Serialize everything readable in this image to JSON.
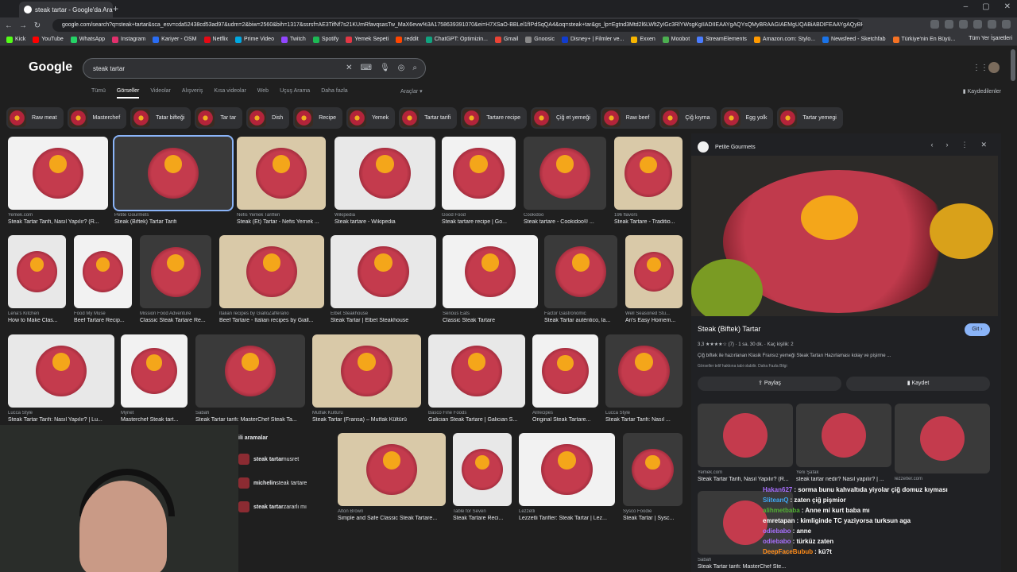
{
  "browser": {
    "tab_title": "steak tartar - Google'da Ara",
    "url": "google.com/search?q=steak+tartar&sca_esv=cda52438cd53ad97&udm=2&biw=2560&bih=1317&ssrsf=AE3TifNf7s21KUmRfavqsasTw_MaX6evw%3A1758639391070&ei=H7XSaO-BBLel1fIPdSqQA4&oq=steak+tar&gs_lp=Egtnd3Mtd2l6LWltZyIGc3RlYWsgKgIIADIIEAAYgAQYsQMyBRAAGIAEMgUQABiABDIFEAAYgAQyBRAAGIA",
    "bookmarks": [
      "Kick",
      "YouTube",
      "WhatsApp",
      "Instagram",
      "Kariyer - OSM",
      "Netflix",
      "Prime Video",
      "Twitch",
      "Spotify",
      "Yemek Sepeti",
      "reddit",
      "ChatGPT: Optimizin...",
      "Gmail",
      "Gnoosic",
      "Disney+ | Filmler ve...",
      "Exxen",
      "Moobot",
      "StreamElements",
      "Amazon.com: Stylo...",
      "Newsfeed - Sketchfab",
      "Türkiye'nin En Büyü..."
    ],
    "bookmarks_right": "Tüm Yer İşaretleri"
  },
  "google": {
    "logo": "Google",
    "query": "steak tartar",
    "nav_tabs": [
      "Tümü",
      "Görseller",
      "Videolar",
      "Alışveriş",
      "Kısa videolar",
      "Web",
      "Uçuş Arama",
      "Daha fazla"
    ],
    "active_tab": "Görseller",
    "tools": "Araçlar",
    "saved": "Kaydedilenler",
    "chips": [
      "Raw meat",
      "Masterchef",
      "Tatar bifteği",
      "Tar tar",
      "Dish",
      "Recipe",
      "Yemek",
      "Tartar tarifi",
      "Tartare recipe",
      "Çiğ et yemeği",
      "Raw beef",
      "Çiğ kıyma",
      "Egg yolk",
      "Tartar yemegi"
    ]
  },
  "results": [
    {
      "src": "Yemek.com",
      "cap": "Steak Tartar Tarifi, Nasıl Yapılır? (R..."
    },
    {
      "src": "Petite Gourmets",
      "cap": "Steak (Biftek) Tartar Tarifi"
    },
    {
      "src": "Nefis Yemek Tarifleri",
      "cap": "Steak (Et) Tartar - Nefis Yemek ..."
    },
    {
      "src": "Wikipedia",
      "cap": "Steak tartare - Wikipedia"
    },
    {
      "src": "Good Food",
      "cap": "Steak tartare recipe | Go..."
    },
    {
      "src": "Cookidoo",
      "cap": "Steak tartare - Cookidoo® ..."
    },
    {
      "src": "196 flavors",
      "cap": "Steak Tartare - Traditio..."
    },
    {
      "src": "Lena's Kitchen",
      "cap": "How to Make Clas..."
    },
    {
      "src": "Food My Muse",
      "cap": "Beef Tartare Recip..."
    },
    {
      "src": "Mission Food Adventure",
      "cap": "Classic Steak Tartare Re..."
    },
    {
      "src": "Italian recipes by GialloZafferano",
      "cap": "Beef Tartare - Italian recipes by Giall..."
    },
    {
      "src": "Elbet Steakhouse",
      "cap": "Steak Tartar | Elbet Steakhouse"
    },
    {
      "src": "Serious Eats",
      "cap": "Classic Steak Tartare"
    },
    {
      "src": "Factor Gastronómic",
      "cap": "Steak Tartar auténtico, la..."
    },
    {
      "src": "Well Seasoned Stu...",
      "cap": "Ari's Easy Homem..."
    },
    {
      "src": "Lucca Style",
      "cap": "Steak Tartar Tarifi: Nasıl Yapılır? | Lu..."
    },
    {
      "src": "Mynet",
      "cap": "Masterchef Steak tart..."
    },
    {
      "src": "Sabah",
      "cap": "Steak Tartar tarifi: MasterChef Steak Ta..."
    },
    {
      "src": "Mutfak Kültürü",
      "cap": "Steak Tartar (Fransa) – Mutfak Kültürü"
    },
    {
      "src": "Basco Fine Foods",
      "cap": "Galician Steak Tartare | Galician S..."
    },
    {
      "src": "Allrecipes",
      "cap": "Original Steak Tartare..."
    },
    {
      "src": "Lucca Style",
      "cap": "Steak Tartar Tarifi: Nasıl ..."
    },
    {
      "src": "Alton Brown",
      "cap": "Simple and Safe Classic Steak Tartare..."
    },
    {
      "src": "Table for Seven",
      "cap": "Steak Tartare Reci..."
    },
    {
      "src": "Lezzetli",
      "cap": "Lezzetli Tarifler: Steak Tartar | Lez..."
    },
    {
      "src": "Sysco Foodie",
      "cap": "Steak Tartar | Sysc..."
    }
  ],
  "related": {
    "title": "ili aramalar",
    "items": [
      {
        "bold": "steak tartar",
        "rest": " nusret"
      },
      {
        "bold": "michelin",
        "rest": " steak tartare"
      },
      {
        "bold": "steak tartar",
        "rest": " zararlı mı"
      }
    ]
  },
  "panel": {
    "source": "Petite Gourmets",
    "title": "Steak (Biftek) Tartar",
    "visit": "Git",
    "meta": "3,3 ★★★★☆ (7)  ·  1 sa. 30 dk.  ·  Kaç kişilik: 2",
    "desc": "Çiğ biftek ile hazırlanan Klasik Fransız yemeği Steak Tartarı Hazırlaması kolay ve pişirme ...",
    "note": "Görseller telif hakkına tabi olabilir. Daha Fazla Bilgi",
    "share": "Paylaş",
    "save": "Kaydet",
    "related": [
      {
        "src": "Yemek.com",
        "cap": "Steak Tartar Tarifi, Nasıl Yapılır? (R..."
      },
      {
        "src": "Yeni Şafak",
        "cap": "steak tartar nedir? Nasıl yapılır? | ..."
      },
      {
        "src": "lezzetler.com",
        "cap": ""
      },
      {
        "src": "Sabah",
        "cap": "Steak Tartar tarifi: MasterChef Ste..."
      }
    ]
  },
  "chat": [
    {
      "user": "Hakan627",
      "text": "sorma bunu kahvaltıda yiyolar çiğ domuz kıyması",
      "color": "#a970ff"
    },
    {
      "user": "SliteanQ",
      "text": "zaten çiğ pişmior",
      "color": "#3fa9f5"
    },
    {
      "user": "alihmetbaba",
      "text": "Anne mi kurt baba mı",
      "color": "#53b333"
    },
    {
      "user": "emretapan",
      "text": "kimliginde TC yaziyorsa turksun aga",
      "color": "#ffffff"
    },
    {
      "user": "odiebabo",
      "text": "anne",
      "color": "#a970ff"
    },
    {
      "user": "odiebabo",
      "text": "türküz zaten",
      "color": "#a970ff"
    },
    {
      "user": "DeepFaceBubub",
      "text": "kü?t",
      "color": "#ff8c1a"
    }
  ]
}
